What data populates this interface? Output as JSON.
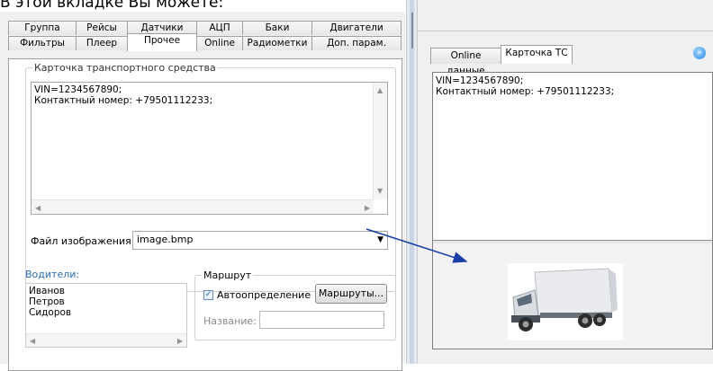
{
  "header": {
    "text": "В этой вкладке Вы можете:"
  },
  "left": {
    "tabs_row1": [
      "Группа",
      "Рейсы",
      "Датчики",
      "АЦП",
      "Баки",
      "Двигатели"
    ],
    "tabs_row2": [
      "Фильтры",
      "Плеер",
      "Прочее",
      "Online",
      "Радиометки",
      "Доп. парам."
    ],
    "active_tab": "Прочее",
    "vehicle_card": {
      "title": "Карточка транспортного средства",
      "lines": [
        "VIN=1234567890;",
        "Контактный номер: +79501112233;"
      ]
    },
    "image_file": {
      "label": "Файл изображения:",
      "value": "image.bmp"
    },
    "drivers": {
      "title": "Водители:",
      "items": [
        "Иванов",
        "Петров",
        "Сидоров"
      ]
    },
    "route": {
      "title": "Маршрут",
      "auto_label": "Автоопределение",
      "auto_checked": true,
      "routes_button": "Маршруты...",
      "name_label": "Название:",
      "name_value": ""
    }
  },
  "right": {
    "tabs": [
      "Online данные",
      "Карточка ТС"
    ],
    "active_tab": "Карточка ТС",
    "card_lines": [
      "VIN=1234567890;",
      "Контактный номер: +79501112233;"
    ],
    "collapse_icon": "double-chevron-right-icon"
  },
  "colors": {
    "accent": "#1a3fa8",
    "drivers_title": "#2a6ebb",
    "checkbox": "#1e5fb3"
  }
}
